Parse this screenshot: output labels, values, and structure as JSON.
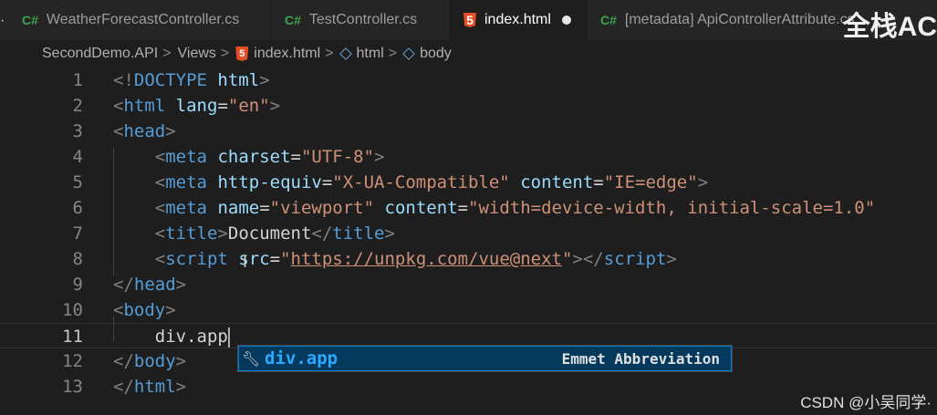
{
  "tabs": [
    {
      "icon": "C#",
      "label": "WeatherForecastController.cs",
      "active": false
    },
    {
      "icon": "C#",
      "label": "TestController.cs",
      "active": false
    },
    {
      "icon": "5",
      "label": "index.html",
      "active": true
    },
    {
      "icon": "C#",
      "label": "[metadata] ApiControllerAttribute.cs",
      "active": false
    }
  ],
  "watermark": "全栈AC",
  "breadcrumb": {
    "items": [
      "SecondDemo.API",
      "Views",
      "index.html",
      "html",
      "body"
    ],
    "separator": ">"
  },
  "editor": {
    "line_numbers": [
      "1",
      "2",
      "3",
      "4",
      "5",
      "6",
      "7",
      "8",
      "9",
      "10",
      "11",
      "12",
      "13"
    ],
    "current_line": "11",
    "typed_text": "div.app",
    "lines": [
      [
        [
          "p",
          "<!"
        ],
        [
          "t",
          "DOCTYPE"
        ],
        [
          "e",
          " "
        ],
        [
          "a",
          "html"
        ],
        [
          "p",
          ">"
        ]
      ],
      [
        [
          "p",
          "<"
        ],
        [
          "t",
          "html"
        ],
        [
          "e",
          " "
        ],
        [
          "a",
          "lang"
        ],
        [
          "e",
          "="
        ],
        [
          "s",
          "\"en\""
        ],
        [
          "p",
          ">"
        ]
      ],
      [
        [
          "p",
          "<"
        ],
        [
          "t",
          "head"
        ],
        [
          "p",
          ">"
        ]
      ],
      [
        [
          "e",
          "    "
        ],
        [
          "p",
          "<"
        ],
        [
          "t",
          "meta"
        ],
        [
          "e",
          " "
        ],
        [
          "a",
          "charset"
        ],
        [
          "e",
          "="
        ],
        [
          "s",
          "\"UTF-8\""
        ],
        [
          "p",
          ">"
        ]
      ],
      [
        [
          "e",
          "    "
        ],
        [
          "p",
          "<"
        ],
        [
          "t",
          "meta"
        ],
        [
          "e",
          " "
        ],
        [
          "a",
          "http-equiv"
        ],
        [
          "e",
          "="
        ],
        [
          "s",
          "\"X-UA-Compatible\""
        ],
        [
          "e",
          " "
        ],
        [
          "a",
          "content"
        ],
        [
          "e",
          "="
        ],
        [
          "s",
          "\"IE=edge\""
        ],
        [
          "p",
          ">"
        ]
      ],
      [
        [
          "e",
          "    "
        ],
        [
          "p",
          "<"
        ],
        [
          "t",
          "meta"
        ],
        [
          "e",
          " "
        ],
        [
          "a",
          "name"
        ],
        [
          "e",
          "="
        ],
        [
          "s",
          "\"viewport\""
        ],
        [
          "e",
          " "
        ],
        [
          "a",
          "content"
        ],
        [
          "e",
          "="
        ],
        [
          "s",
          "\"width=device-width, initial-scale=1.0\""
        ]
      ],
      [
        [
          "e",
          "    "
        ],
        [
          "p",
          "<"
        ],
        [
          "t",
          "title"
        ],
        [
          "p",
          ">"
        ],
        [
          "x",
          "Document"
        ],
        [
          "p",
          "</"
        ],
        [
          "t",
          "title"
        ],
        [
          "p",
          ">"
        ]
      ],
      [
        [
          "e",
          "    "
        ],
        [
          "p",
          "<"
        ],
        [
          "t",
          "script"
        ],
        [
          "e",
          " "
        ],
        [
          "a",
          "src"
        ],
        [
          "e",
          "="
        ],
        [
          "s",
          "\""
        ],
        [
          "u",
          "https://unpkg.com/vue@next"
        ],
        [
          "s",
          "\""
        ],
        [
          "p",
          "></"
        ],
        [
          "t",
          "script"
        ],
        [
          "p",
          ">"
        ]
      ],
      [
        [
          "p",
          "</"
        ],
        [
          "t",
          "head"
        ],
        [
          "p",
          ">"
        ]
      ],
      [
        [
          "p",
          "<"
        ],
        [
          "t",
          "body"
        ],
        [
          "p",
          ">"
        ]
      ],
      [
        [
          "e",
          "    "
        ],
        [
          "x",
          "div.app"
        ]
      ],
      [
        [
          "p",
          "</"
        ],
        [
          "t",
          "body"
        ],
        [
          "p",
          ">"
        ]
      ],
      [
        [
          "p",
          "</"
        ],
        [
          "t",
          "html"
        ],
        [
          "p",
          ">"
        ]
      ]
    ]
  },
  "suggestion": {
    "icon": "wrench-icon",
    "label": "div.app",
    "detail": "Emmet Abbreviation"
  },
  "csdn_watermark": "CSDN @小吴同学·",
  "colors": {
    "tag": "#569cd6",
    "attribute": "#9cdcfe",
    "string": "#ce9178",
    "punctuation": "#808080",
    "suggestion_highlight": "#2aaaff",
    "csharp_icon": "#3fa34d",
    "html_icon": "#e44d26"
  }
}
